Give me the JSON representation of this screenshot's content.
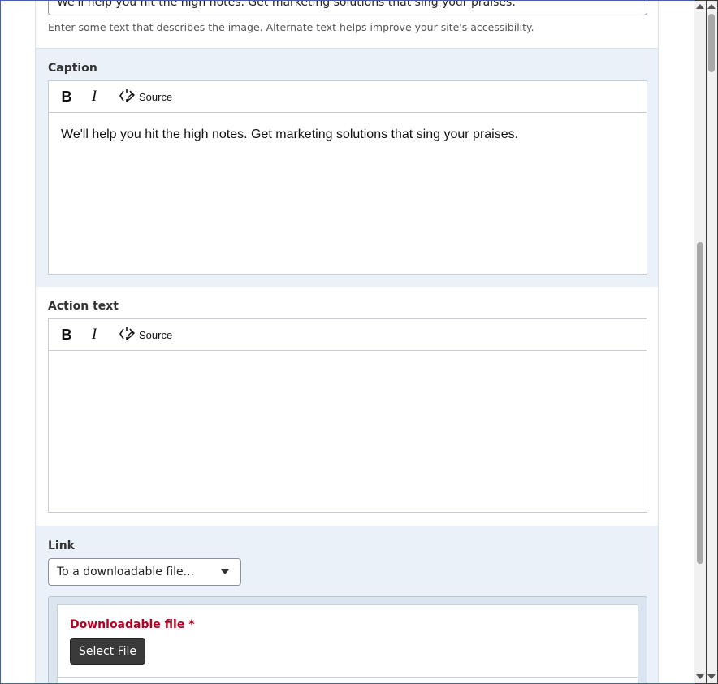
{
  "alt_text": {
    "value": "We'll help you hit the high notes. Get marketing solutions that sing your praises.",
    "help": "Enter some text that describes the image. Alternate text helps improve your site's accessibility."
  },
  "caption": {
    "label": "Caption",
    "toolbar": {
      "bold": "B",
      "italic": "I",
      "source": "Source"
    },
    "content": "We'll help you hit the high notes. Get marketing solutions that sing your praises."
  },
  "action_text": {
    "label": "Action text",
    "toolbar": {
      "bold": "B",
      "italic": "I",
      "source": "Source"
    },
    "content": ""
  },
  "link": {
    "label": "Link",
    "selected": "To a downloadable file...",
    "downloadable": {
      "label": "Downloadable file",
      "required_marker": "*",
      "button": "Select File"
    }
  },
  "icons": {
    "caret": "chevron-down-icon",
    "source": "source-code-icon"
  },
  "colors": {
    "panel_blue": "#eaf1f8",
    "required": "#b00020",
    "modal_border": "#3f5fae"
  }
}
